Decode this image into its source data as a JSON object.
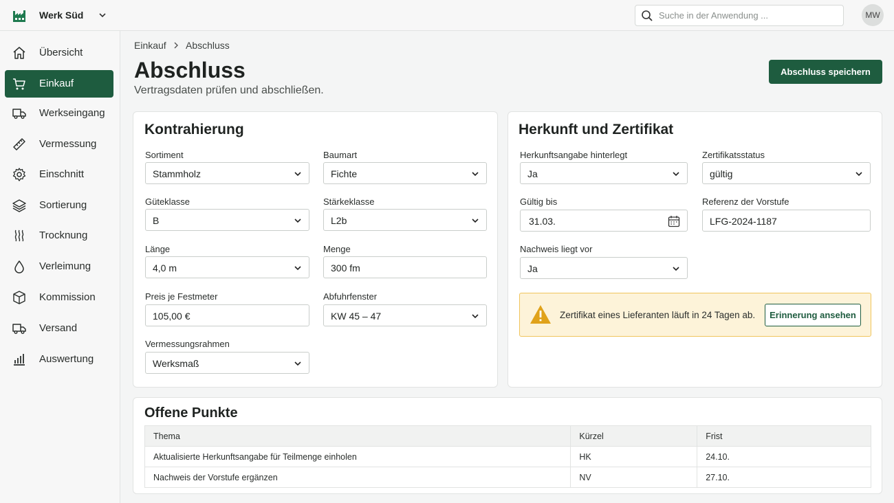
{
  "header": {
    "plant": "Werk Süd",
    "search_placeholder": "Suche in der Anwendung ...",
    "avatar": "MW"
  },
  "sidebar": {
    "items": [
      {
        "label": "Übersicht",
        "icon": "home-icon"
      },
      {
        "label": "Einkauf",
        "icon": "cart-icon",
        "active": true
      },
      {
        "label": "Werkseingang",
        "icon": "truck-icon"
      },
      {
        "label": "Vermessung",
        "icon": "ruler-icon"
      },
      {
        "label": "Einschnitt",
        "icon": "saw-gear-icon"
      },
      {
        "label": "Sortierung",
        "icon": "layers-icon"
      },
      {
        "label": "Trocknung",
        "icon": "heat-waves-icon"
      },
      {
        "label": "Verleimung",
        "icon": "drop-icon"
      },
      {
        "label": "Kommission",
        "icon": "box-icon"
      },
      {
        "label": "Versand",
        "icon": "truck-icon"
      },
      {
        "label": "Auswertung",
        "icon": "bar-chart-icon"
      }
    ]
  },
  "breadcrumb": [
    "Einkauf",
    "Abschluss"
  ],
  "page": {
    "title": "Abschluss",
    "subtitle": "Vertragsdaten prüfen und abschließen.",
    "save_label": "Abschluss speichern"
  },
  "kontrahierung": {
    "title": "Kontrahierung",
    "sortiment": {
      "label": "Sortiment",
      "value": "Stammholz"
    },
    "baumart": {
      "label": "Baumart",
      "value": "Fichte"
    },
    "gueteklasse": {
      "label": "Güteklasse",
      "value": "B"
    },
    "staerkeklasse": {
      "label": "Stärkeklasse",
      "value": "L2b"
    },
    "laenge": {
      "label": "Länge",
      "value": "4,0 m"
    },
    "menge": {
      "label": "Menge",
      "value": "300 fm"
    },
    "preis": {
      "label": "Preis je Festmeter",
      "value": "105,00 €"
    },
    "abfuhr": {
      "label": "Abfuhrfenster",
      "value": "KW 45 – 47"
    },
    "vermessung": {
      "label": "Vermessungsrahmen",
      "value": "Werksmaß"
    }
  },
  "herkunft": {
    "title": "Herkunft und Zertifikat",
    "herkunftsangabe": {
      "label": "Herkunftsangabe hinterlegt",
      "value": "Ja"
    },
    "zertifikatsstatus": {
      "label": "Zertifikatsstatus",
      "value": "gültig"
    },
    "gueltig_bis": {
      "label": "Gültig bis",
      "value": "31.03."
    },
    "referenz": {
      "label": "Referenz der Vorstufe",
      "value": "LFG-2024-1187"
    },
    "nachweis": {
      "label": "Nachweis liegt vor",
      "value": "Ja"
    },
    "alert": {
      "text": "Zertifikat eines Lieferanten läuft in 24 Tagen ab.",
      "button": "Erinnerung ansehen"
    }
  },
  "offene_punkte": {
    "title": "Offene Punkte",
    "columns": [
      "Thema",
      "Kürzel",
      "Frist"
    ],
    "rows": [
      [
        "Aktualisierte Herkunftsangabe für Teilmenge einholen",
        "HK",
        "24.10."
      ],
      [
        "Nachweis der Vorstufe ergänzen",
        "NV",
        "27.10."
      ]
    ]
  },
  "colors": {
    "accent": "#1e5c3f",
    "warning_bg": "#fdf3d9",
    "warning_border": "#f0c45c",
    "warning_icon": "#e0a21a"
  }
}
